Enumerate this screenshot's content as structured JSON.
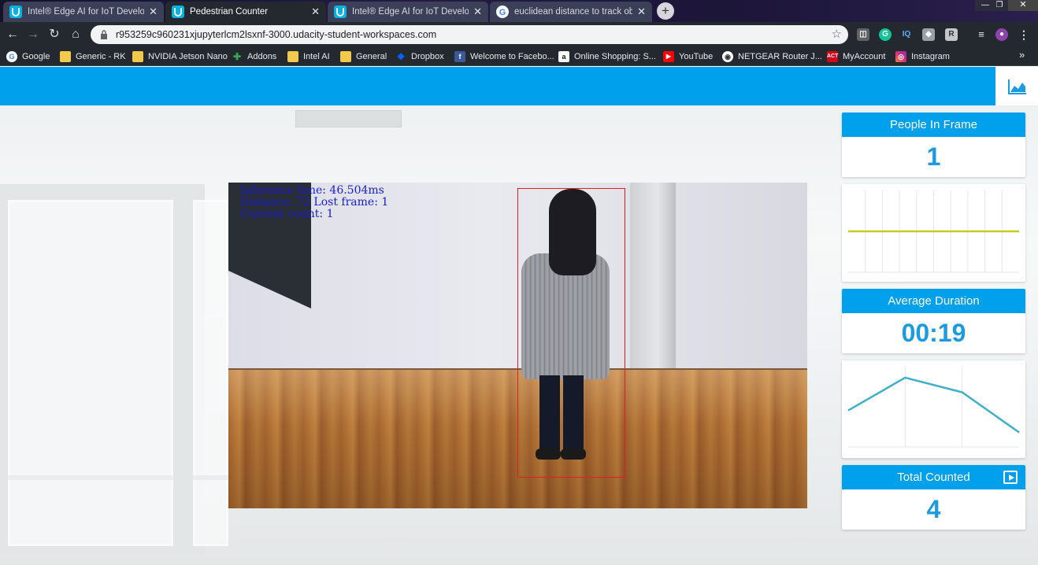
{
  "browser": {
    "tabs": [
      {
        "title": "Intel® Edge AI for IoT Developer",
        "active": false
      },
      {
        "title": "Pedestrian Counter",
        "active": true
      },
      {
        "title": "Intel® Edge AI for IoT Developer",
        "active": false
      },
      {
        "title": "euclidean distance to track object",
        "active": false
      }
    ],
    "url": "r953259c960231xjupyterlcm2lsxnf-3000.udacity-student-workspaces.com",
    "bookmarks": [
      {
        "label": "Google",
        "icon": "google-icon"
      },
      {
        "label": "Generic - RK",
        "icon": "folder-icon"
      },
      {
        "label": "NVIDIA Jetson Nano",
        "icon": "folder-icon"
      },
      {
        "label": "Addons",
        "icon": "puzzle-icon"
      },
      {
        "label": "Intel AI",
        "icon": "folder-icon"
      },
      {
        "label": "General",
        "icon": "folder-icon"
      },
      {
        "label": "Dropbox",
        "icon": "dropbox-icon"
      },
      {
        "label": "Welcome to Facebo...",
        "icon": "facebook-icon"
      },
      {
        "label": "Online Shopping: S...",
        "icon": "amazon-icon"
      },
      {
        "label": "YouTube",
        "icon": "youtube-icon"
      },
      {
        "label": "NETGEAR Router J...",
        "icon": "netgear-icon"
      },
      {
        "label": "MyAccount",
        "icon": "act-icon"
      },
      {
        "label": "Instagram",
        "icon": "instagram-icon"
      }
    ],
    "bookmarks_more": "»"
  },
  "video": {
    "overlay_lines": [
      "Inference time: 46.504ms",
      "Distance: 72 Lost frame: 1",
      "Current count: 1"
    ]
  },
  "stats": {
    "people_in_frame": {
      "label": "People In Frame",
      "value": "1"
    },
    "average_duration": {
      "label": "Average Duration",
      "value": "00:19"
    },
    "total_counted": {
      "label": "Total Counted",
      "value": "4"
    }
  },
  "colors": {
    "accent": "#00a0ec",
    "value_text": "#1d9be0",
    "people_line": "#c5cc1f",
    "duration_line": "#3eb0c8"
  },
  "chart_data": [
    {
      "type": "line",
      "title": "",
      "series": [
        {
          "values": [
            1,
            1,
            1,
            1,
            1,
            1,
            1,
            1,
            1,
            1
          ]
        }
      ],
      "grid": true
    },
    {
      "type": "line",
      "title": "",
      "series": [
        {
          "values": [
            10,
            19,
            15,
            4
          ]
        }
      ],
      "grid": true
    }
  ]
}
